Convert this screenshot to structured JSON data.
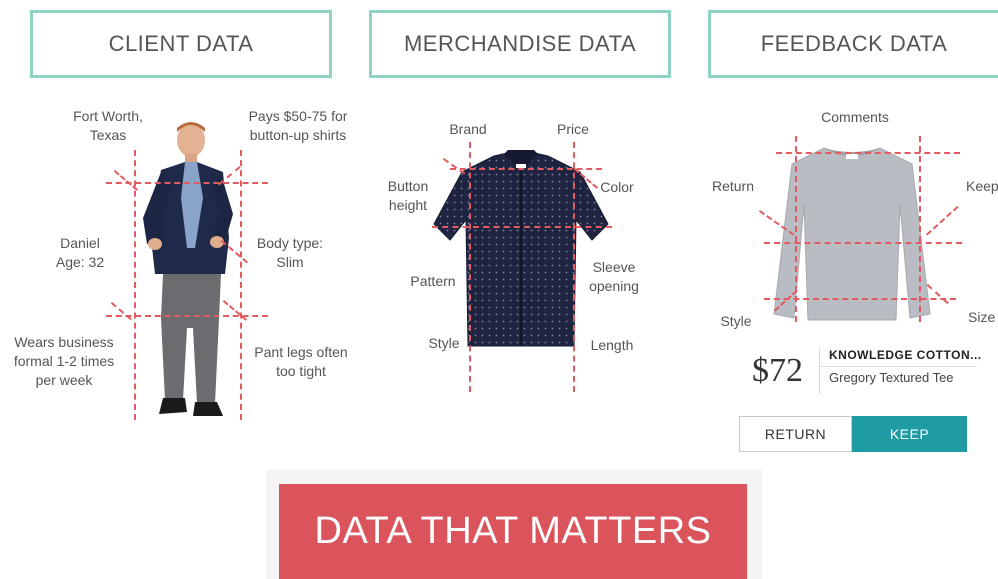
{
  "headers": {
    "client": "CLIENT DATA",
    "merchandise": "MERCHANDISE DATA",
    "feedback": "FEEDBACK DATA"
  },
  "client": {
    "location": [
      "Fort Worth,",
      "Texas"
    ],
    "budget": [
      "Pays $50-75 for",
      "button-up shirts"
    ],
    "name": [
      "Daniel",
      "Age: 32"
    ],
    "body_type": [
      "Body type:",
      "Slim"
    ],
    "dress": [
      "Wears business",
      "formal 1-2 times",
      "per week"
    ],
    "pants": [
      "Pant legs often",
      "too tight"
    ]
  },
  "merchandise": {
    "brand": "Brand",
    "price": "Price",
    "button_height": [
      "Button",
      "height"
    ],
    "color": "Color",
    "pattern": "Pattern",
    "sleeve": [
      "Sleeve",
      "opening"
    ],
    "style": "Style",
    "length": "Length"
  },
  "feedback": {
    "comments": "Comments",
    "return": "Return",
    "keep": "Keep",
    "style": "Style",
    "size": "Size",
    "product": {
      "price": "$72",
      "name": "KNOWLEDGE COTTON...",
      "subtitle": "Gregory Textured Tee"
    },
    "buttons": {
      "return": "RETURN",
      "keep": "KEEP"
    }
  },
  "banner": "DATA THAT MATTERS",
  "colors": {
    "header_border": "#8fd3c3",
    "dash": "#e25b61",
    "banner_bg": "#dc545b",
    "keep_button": "#1f9ba3",
    "shirt": "#1f2440",
    "sweater": "#b9bcc2"
  }
}
